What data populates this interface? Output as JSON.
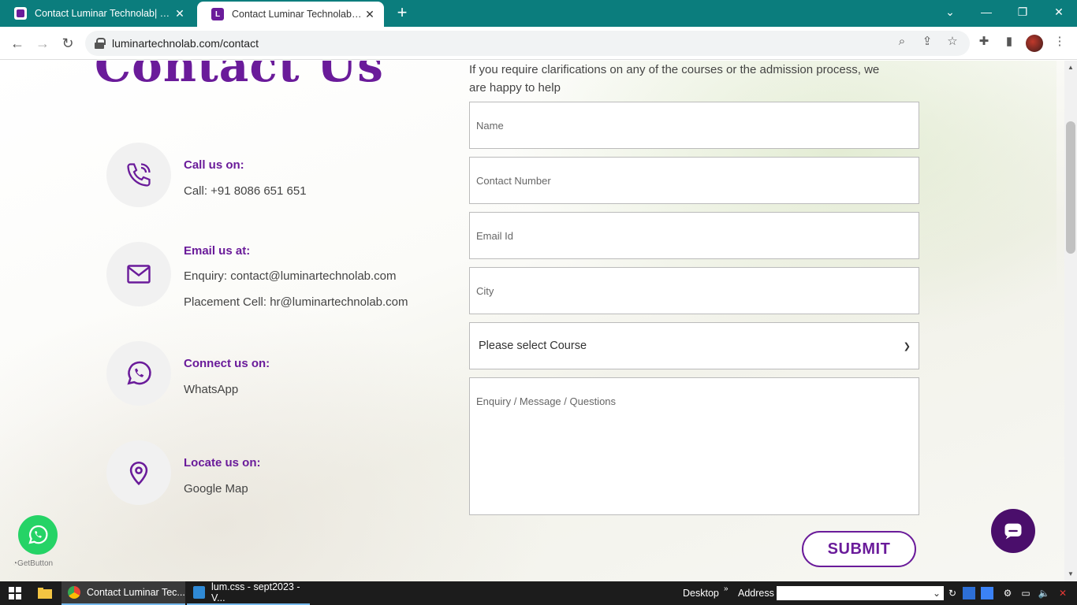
{
  "browser": {
    "tabs": [
      {
        "title": "Contact Luminar Technolab| No.",
        "active": false
      },
      {
        "title": "Contact Luminar Technolab| No.",
        "active": true
      }
    ],
    "new_tab": "+",
    "url": "luminartechnolab.com/contact"
  },
  "page": {
    "heading": "Contact Us",
    "intro": "If you require clarifications on any of the courses or the admission process, we are happy to help",
    "contacts": [
      {
        "icon": "phone-icon",
        "title": "Call us on:",
        "lines": [
          "Call: +91 8086 651 651"
        ]
      },
      {
        "icon": "mail-icon",
        "title": "Email us at:",
        "lines": [
          "Enquiry: contact@luminartechnolab.com",
          "Placement Cell: hr@luminartechnolab.com"
        ]
      },
      {
        "icon": "whatsapp-icon",
        "title": "Connect us on:",
        "lines": [
          "WhatsApp"
        ]
      },
      {
        "icon": "location-pin-icon",
        "title": "Locate us on:",
        "lines": [
          "Google Map"
        ]
      }
    ],
    "form": {
      "name_placeholder": "Name",
      "contact_placeholder": "Contact Number",
      "email_placeholder": "Email Id",
      "city_placeholder": "City",
      "course_selected": "Please select Course",
      "message_placeholder": "Enquiry / Message / Questions",
      "submit_label": "SUBMIT"
    },
    "getbutton_label": "GetButton",
    "accent_color": "#6a1b9a"
  },
  "taskbar": {
    "apps": [
      {
        "label": "Contact Luminar Tec...",
        "icon": "chrome-icon"
      },
      {
        "label": "lum.css - sept2023 - V...",
        "icon": "vscode-icon"
      }
    ],
    "desktop_label": "Desktop",
    "address_label": "Address"
  }
}
